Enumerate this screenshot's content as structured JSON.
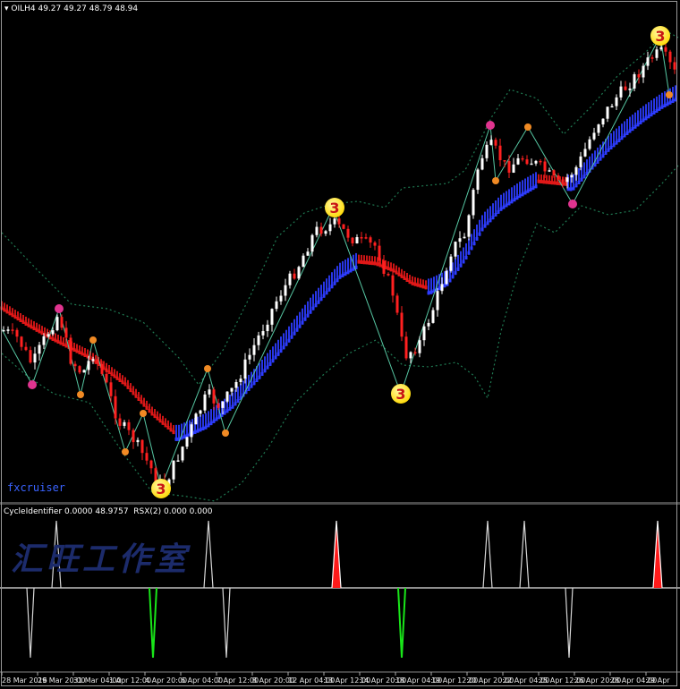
{
  "header": {
    "symbol_text": "▾ OILH4 49.27 49.27 48.79 48.94"
  },
  "brand": {
    "text": "fxcruiser"
  },
  "indicator": {
    "header_text": "CycleIdentifier 0.0000 48.9757  RSX(2) 0.000 0.000",
    "cn_watermark": "汇旺工作室"
  },
  "time_axis": {
    "labels": [
      "28 Mar 2016",
      "29 Mar 20:00",
      "31 Mar 04:00",
      "1 Apr 12:00",
      "4 Apr 20:00",
      "6 Apr 04:00",
      "7 Apr 12:00",
      "8 Apr 20:00",
      "12 Apr 04:00",
      "13 Apr 12:00",
      "14 Apr 20:00",
      "18 Apr 04:00",
      "19 Apr 12:00",
      "20 Apr 20:00",
      "22 Apr 04:00",
      "25 Apr 12:00",
      "26 Apr 20:00",
      "28 Apr 04:00",
      "29 Apr"
    ]
  },
  "markers": {
    "big_label": "3"
  },
  "colors": {
    "bull_band": "#2d3cff",
    "bear_band": "#e01818",
    "candle_up": "#ffffff",
    "candle_down": "#ff2020",
    "envelope": "#1f7a52",
    "zigzag": "#56c6a2",
    "marker_yellow": "#ffe600",
    "marker_orange": "#f08a24",
    "marker_pink": "#e0348f",
    "spike_green": "#19e619",
    "spike_red": "#ff1a1a"
  }
}
